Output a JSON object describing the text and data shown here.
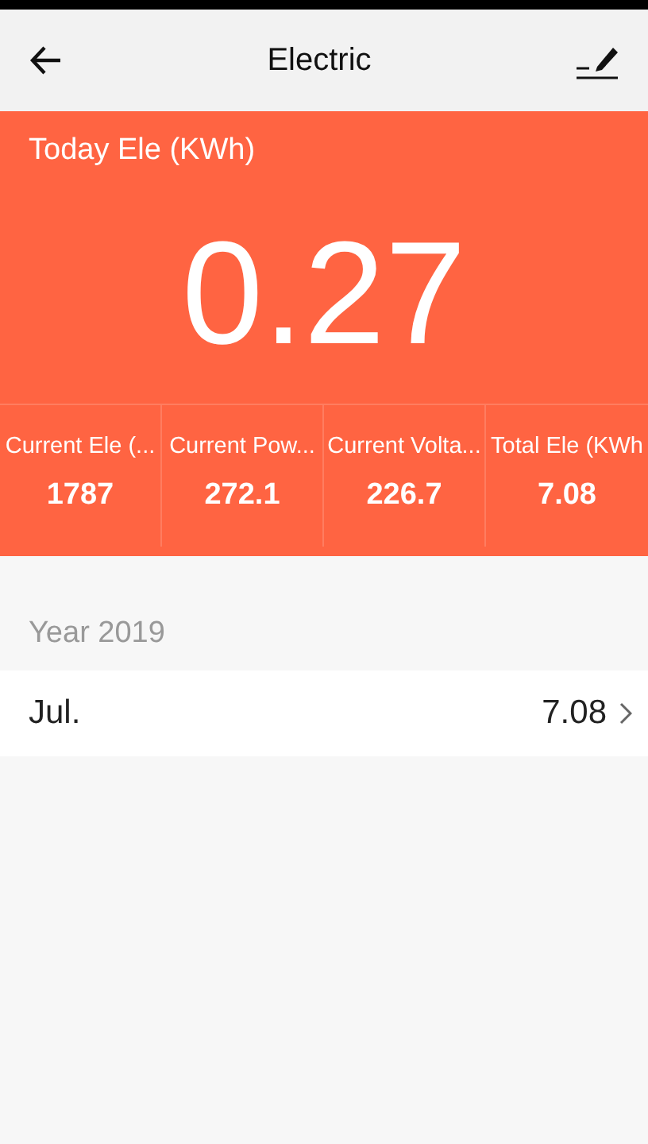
{
  "header": {
    "title": "Electric"
  },
  "today": {
    "label": "Today Ele (KWh)",
    "value": "0.27"
  },
  "stats": [
    {
      "label": "Current Ele (...",
      "value": "1787"
    },
    {
      "label": "Current Pow...",
      "value": "272.1"
    },
    {
      "label": "Current Volta...",
      "value": "226.7"
    },
    {
      "label": "Total Ele (KWh",
      "value": "7.08"
    }
  ],
  "history": {
    "year": "Year 2019",
    "months": [
      {
        "month": "Jul.",
        "value": "7.08"
      }
    ]
  }
}
